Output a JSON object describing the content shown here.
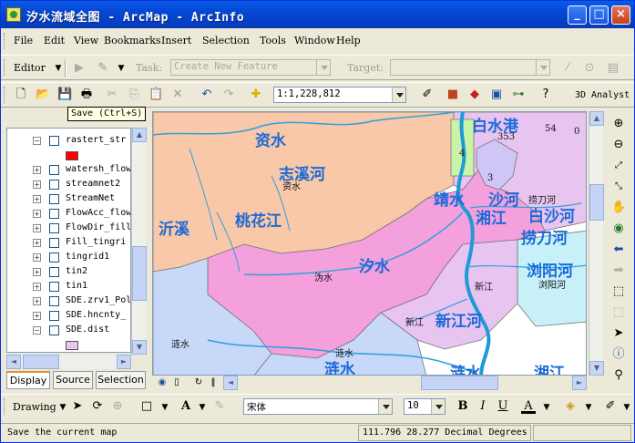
{
  "window": {
    "title": "汐水流域全图 - ArcMap - ArcInfo",
    "minimize": "_",
    "maximize": "□",
    "close": "×"
  },
  "menu": [
    "File",
    "Edit",
    "View",
    "Bookmarks",
    "Insert",
    "Selection",
    "Tools",
    "Window",
    "Help"
  ],
  "editor_toolbar": {
    "editor_label": "Editor",
    "task_label": "Task:",
    "task_value": "Create New Feature",
    "target_label": "Target:",
    "target_value": ""
  },
  "standard_toolbar": {
    "scale_value": "1:1,228,812",
    "analyst_label": "3D Analyst"
  },
  "tooltip": "Save (Ctrl+S)",
  "toc": {
    "layers": [
      {
        "name": "rastert_str",
        "expanded": true,
        "legend_color": "#ff0000"
      },
      {
        "name": "watersh_flow",
        "expanded": false
      },
      {
        "name": "streamnet2",
        "expanded": false
      },
      {
        "name": "StreamNet",
        "expanded": false
      },
      {
        "name": "FlowAcc_flow",
        "expanded": false
      },
      {
        "name": "FlowDir_fill",
        "expanded": false
      },
      {
        "name": "Fill_tingri",
        "expanded": false
      },
      {
        "name": "tingrid1",
        "expanded": false
      },
      {
        "name": "tin2",
        "expanded": false
      },
      {
        "name": "tin1",
        "expanded": false
      },
      {
        "name": "SDE.zrv1_Pol",
        "expanded": false
      },
      {
        "name": "SDE.hncnty_",
        "expanded": false
      },
      {
        "name": "SDE.dist",
        "expanded": true,
        "legend_color": "#e6c8e8"
      }
    ],
    "tabs": [
      "Display",
      "Source",
      "Selection"
    ]
  },
  "map": {
    "big_labels": [
      "资水",
      "志溪河",
      "沂溪",
      "桃花江",
      "靖水",
      "沙河",
      "湘江",
      "白沙河",
      "捞刀河",
      "汐水",
      "浏阳河",
      "新江河",
      "涟水",
      "涟水",
      "湘江",
      "白水港"
    ],
    "small_labels": [
      "资水",
      "沩水",
      "新江",
      "新江",
      "涟水",
      "涟水",
      "捞刀河",
      "浏阳河"
    ],
    "basin_numbers": [
      "353",
      "54",
      "0",
      "4",
      "3"
    ],
    "colors": {
      "peach": "#f8c8a8",
      "pink": "#f4a0dc",
      "violet": "#e8c4f0",
      "lilac": "#cfc6f5",
      "cyan": "#c8f0f8",
      "blue_gray": "#c8d8f8",
      "green": "#c8f4a8",
      "river": "#2ea0e0",
      "main_river": "#1e9ad8"
    }
  },
  "drawing_toolbar": {
    "drawing_label": "Drawing",
    "font_name": "宋体",
    "font_size": "10"
  },
  "status": {
    "message": "Save the current map",
    "coordinates": "111.796  28.277 Decimal Degrees"
  }
}
